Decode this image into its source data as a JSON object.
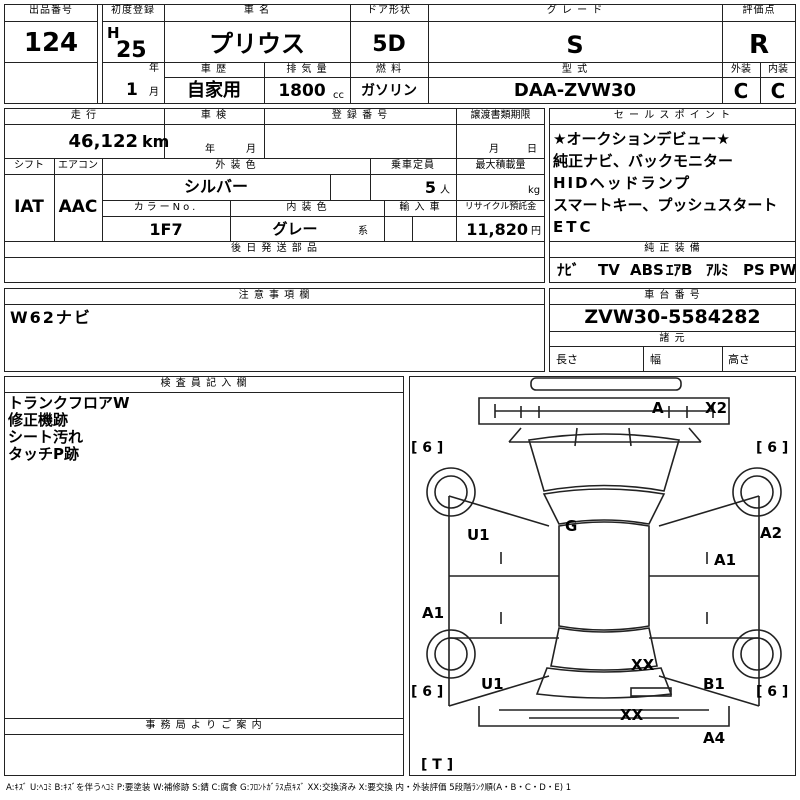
{
  "header": {
    "lot_number_label": "出品番号",
    "lot_number": "124",
    "first_reg_label": "初度登録",
    "era": "H",
    "year": "25",
    "year_unit": "年",
    "month": "1",
    "month_unit": "月",
    "car_name_label": "車 名",
    "car_name": "プリウス",
    "door_label": "ドア形状",
    "door": "5D",
    "grade_label": "グ レ ー ド",
    "grade": "S",
    "score_label": "評価点",
    "score": "R",
    "history_label": "車 歴",
    "history": "自家用",
    "displacement_label": "排 気 量",
    "displacement": "1800",
    "displacement_unit": "cc",
    "fuel_label": "燃 料",
    "fuel": "ガソリン",
    "model_label": "型 式",
    "model": "DAA-ZVW30",
    "exterior_label": "外装",
    "exterior": "C",
    "interior_label": "内装",
    "interior": "C"
  },
  "specs": {
    "mileage_label": "走 行",
    "mileage": "46,122",
    "mileage_unit": "km",
    "inspection_label": "車 検",
    "inspection_year_unit": "年",
    "inspection_month_unit": "月",
    "registration_label": "登 録 番 号",
    "transfer_label": "譲渡書類期限",
    "transfer_month_unit": "月",
    "transfer_day_unit": "日",
    "shift_label": "シフト",
    "shift": "IAT",
    "ac_label": "エアコン",
    "ac": "AAC",
    "ext_color_label": "外 装 色",
    "ext_color": "シルバー",
    "capacity_label": "乗車定員",
    "capacity": "5",
    "capacity_unit": "人",
    "load_label": "最大積載量",
    "load_unit": "kg",
    "color_no_label": "カラーNo.",
    "color_no": "1F7",
    "int_color_label": "内 装 色",
    "int_color": "グレー",
    "int_color_suffix": "系",
    "import_label": "輸 入 車",
    "recycle_label": "リサイクル預託金",
    "recycle": "11,820",
    "recycle_unit": "円",
    "later_parts_label": "後 日 発 送 部 品"
  },
  "sales_points": {
    "label": "セ ー ル ス ポ イ ン ト",
    "lines": [
      "★オークションデビュー★",
      "純正ナビ、バックモニター",
      "HIDヘッドランプ",
      "スマートキー、プッシュスタート",
      "ETC"
    ]
  },
  "equipment": {
    "label": "純 正 装 備",
    "items": [
      "ﾅﾋﾞ",
      "TV",
      "ABS",
      "ｴｱB",
      "ｱﾙﾐ",
      "PS",
      "PW"
    ]
  },
  "notes": {
    "label": "注 意 事 項 欄",
    "text": "W62ナビ"
  },
  "chassis": {
    "label": "車 台 番 号",
    "number": "ZVW30-5584282",
    "spec_label": "諸 元",
    "length_label": "長さ",
    "width_label": "幅",
    "height_label": "高さ"
  },
  "inspector": {
    "label": "検 査 員 記 入 欄",
    "lines": [
      "トランクフロアW",
      "修正機跡",
      "シート汚れ",
      "タッチP跡"
    ]
  },
  "office": {
    "label": "事 務 局 よ り ご 案 内"
  },
  "diagram": {
    "marks": {
      "a_top": "A",
      "x2": "X2",
      "g": "G",
      "u1_left": "U1",
      "a2": "A2",
      "a1_right": "A1",
      "a1_left": "A1",
      "xx_mid": "XX",
      "u1_bottom": "U1",
      "b1": "B1",
      "xx_bottom": "XX",
      "a4": "A4"
    },
    "tire_tl": "[ 6 ]",
    "tire_tr": "[ 6 ]",
    "tire_bl": "[ 6 ]",
    "tire_br": "[ 6 ]",
    "spare": "[ T ]"
  },
  "legend": "A:ｷｽﾞ U:ﾍｺﾐ B:ｷｽﾞを伴うﾍｺﾐ P:要塗装 W:補修跡 S:錆 C:腐食 G:ﾌﾛﾝﾄｶﾞﾗｽ点ｷｽﾞ XX:交換済み X:要交換 内・外装評価 5段階ﾗﾝｸ順(A・B・C・D・E) 1"
}
